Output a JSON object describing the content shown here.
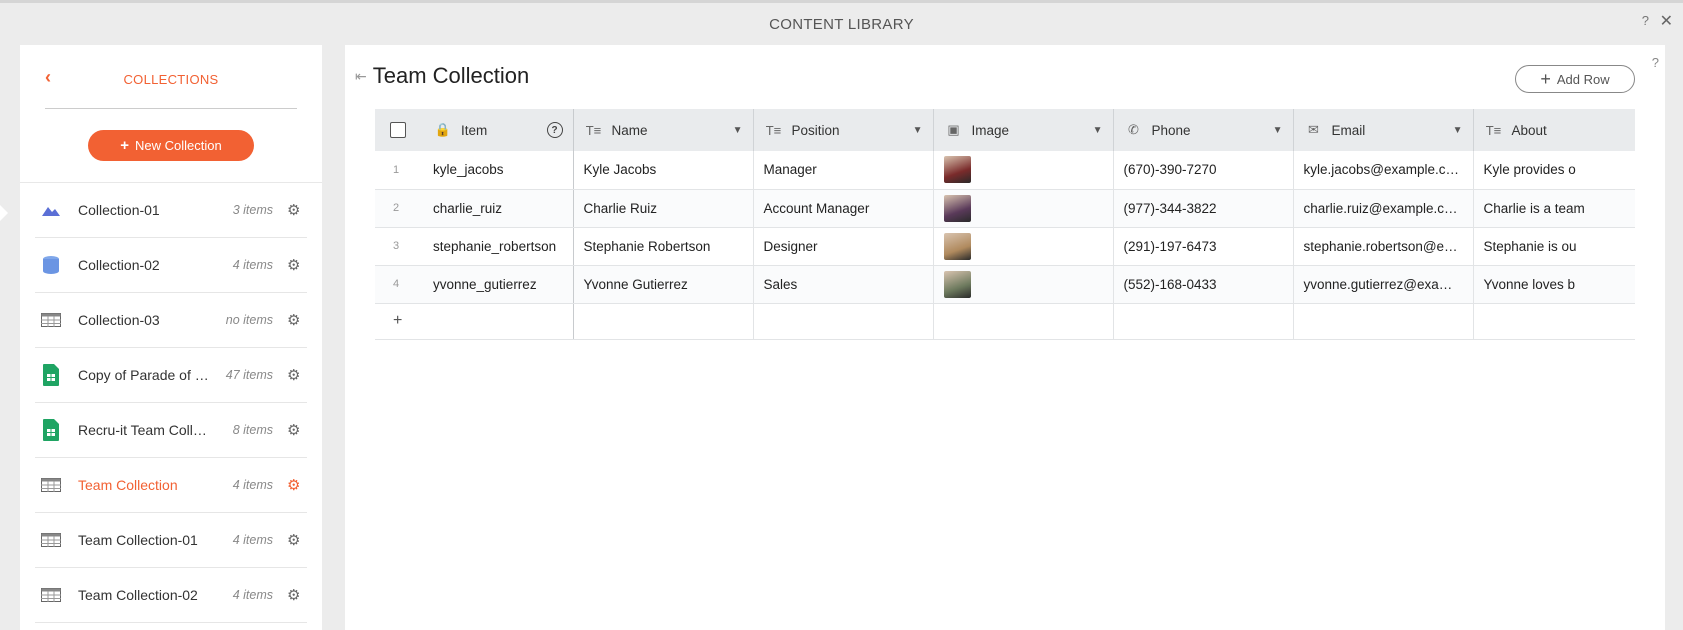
{
  "window": {
    "title": "CONTENT LIBRARY",
    "help": "?",
    "close": "✕"
  },
  "sidebar": {
    "back": "‹",
    "title": "COLLECTIONS",
    "new_button": "New Collection",
    "items": [
      {
        "name": "Collection-01",
        "count": "3 items",
        "icon": "image-icon"
      },
      {
        "name": "Collection-02",
        "count": "4 items",
        "icon": "database-icon"
      },
      {
        "name": "Collection-03",
        "count": "no items",
        "icon": "table-icon"
      },
      {
        "name": "Copy of Parade of …",
        "count": "47 items",
        "icon": "sheets-icon"
      },
      {
        "name": "Recru-it Team Coll…",
        "count": "8 items",
        "icon": "sheets-icon"
      },
      {
        "name": "Team Collection",
        "count": "4 items",
        "icon": "table-icon",
        "active": true
      },
      {
        "name": "Team Collection-01",
        "count": "4 items",
        "icon": "table-icon"
      },
      {
        "name": "Team Collection-02",
        "count": "4 items",
        "icon": "table-icon"
      }
    ]
  },
  "main": {
    "title": "Team Collection",
    "add_row": "Add Row",
    "help": "?",
    "columns": [
      {
        "label": "Item",
        "icon": "lock-icon"
      },
      {
        "label": "Name",
        "icon": "text-icon"
      },
      {
        "label": "Position",
        "icon": "text-icon"
      },
      {
        "label": "Image",
        "icon": "image-icon"
      },
      {
        "label": "Phone",
        "icon": "phone-icon"
      },
      {
        "label": "Email",
        "icon": "email-icon"
      },
      {
        "label": "About",
        "icon": "text-icon"
      }
    ],
    "rows": [
      {
        "n": "1",
        "item": "kyle_jacobs",
        "name": "Kyle Jacobs",
        "position": "Manager",
        "phone": "(670)-390-7270",
        "email": "kyle.jacobs@example.com",
        "about": "Kyle provides o",
        "thumb": "#7a2b2b"
      },
      {
        "n": "2",
        "item": "charlie_ruiz",
        "name": "Charlie Ruiz",
        "position": "Account Manager",
        "phone": "(977)-344-3822",
        "email": "charlie.ruiz@example.com",
        "about": "Charlie is a team",
        "thumb": "#5a3a5a"
      },
      {
        "n": "3",
        "item": "stephanie_robertson",
        "name": "Stephanie Robertson",
        "position": "Designer",
        "phone": "(291)-197-6473",
        "email": "stephanie.robertson@exa…",
        "about": "Stephanie is ou",
        "thumb": "#b08a5e"
      },
      {
        "n": "4",
        "item": "yvonne_gutierrez",
        "name": "Yvonne Gutierrez",
        "position": "Sales",
        "phone": "(552)-168-0433",
        "email": "yvonne.gutierrez@exampl…",
        "about": "Yvonne loves b",
        "thumb": "#6d7a5e"
      }
    ],
    "add_line": "+"
  },
  "colors": {
    "accent": "#f26133"
  }
}
